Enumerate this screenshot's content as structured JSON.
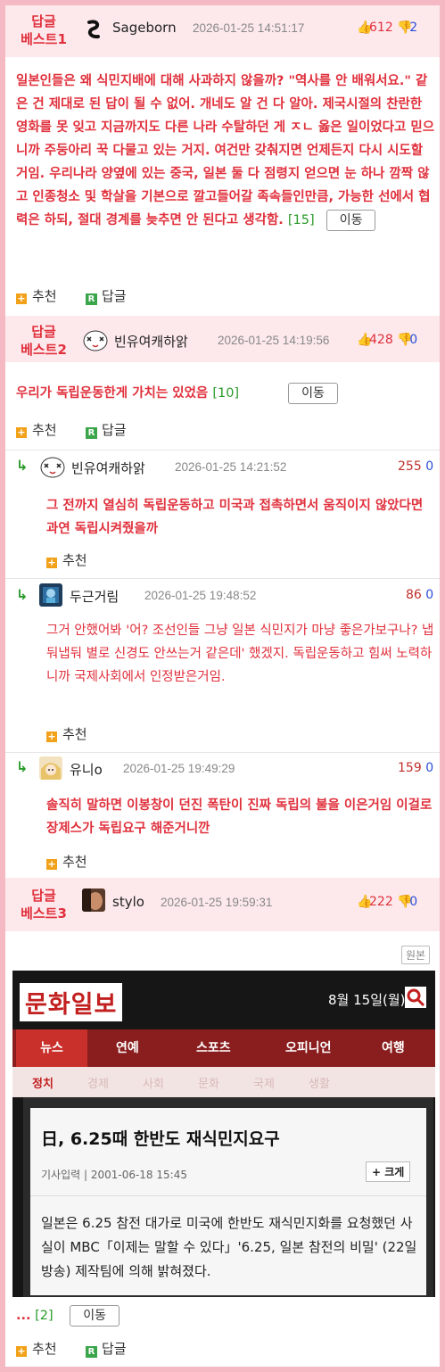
{
  "best1": {
    "tag": "답글\n베스트1",
    "nickname": "Sageborn",
    "date": "2026-01-25 14:51:17",
    "up": "612",
    "down": "2",
    "body": "일본인들은 왜 식민지배에 대해 사과하지 않을까? \"역사를 안 배워서요.\" 같은 건 제대로 된 답이 될 수 없어. 개네도 알 건 다 알아. 제국시절의 찬란한 영화를 못 잊고 지금까지도 다른 나라 수탈하던 게 ㅈㄴ 옳은 일이었다고 믿으니까 주둥아리 꾹 다물고 있는 거지. 여건만 갖춰지면 언제든지 다시 시도할 거임. 우리나라 양옆에 있는 중국, 일본 둘 다 점령지 얻으면 눈 하나 깜짝 않고 인종청소 및 학살을 기본으로 깔고들어갈 족속들인만큼, 가능한 선에서 협력은 하되, 절대 경계를 늦추면 안 된다고 생각함.",
    "reply_count": "[15]",
    "move_label": "이동",
    "recommend": "추천",
    "reply": "답글"
  },
  "best2": {
    "tag": "답글\n베스트2",
    "nickname": "빈유여캐하앍",
    "date": "2026-01-25 14:19:56",
    "up": "428",
    "down": "0",
    "body": "우리가 독립운동한게 가치는 있었음",
    "reply_count": "[10]",
    "move_label": "이동",
    "recommend": "추천",
    "reply": "답글"
  },
  "replies": [
    {
      "nickname": "빈유여캐하앍",
      "date": "2026-01-25 14:21:52",
      "up": "255",
      "down": "0",
      "body": "그 전까지 열심히 독립운동하고 미국과 접촉하면서 움직이지 않았다면 과연 독립시켜줬을까",
      "recommend": "추천"
    },
    {
      "nickname": "두근거림",
      "date": "2026-01-25 19:48:52",
      "up": "86",
      "down": "0",
      "body": "그거 안했어봐 '어? 조선인들 그냥 일본 식민지가 마냥 좋은가보구나? 냅둬냅둬 별로 신경도 안쓰는거 같은데' 했겠지. 독립운동하고 힘써 노력하니까 국제사회에서 인정받은거임.",
      "recommend": "추천"
    },
    {
      "nickname": "유니o",
      "date": "2026-01-25 19:49:29",
      "up": "159",
      "down": "0",
      "body": "솔직히 말하면 이봉창이 던진 폭탄이 진짜 독립의 불을 이은거임 이걸로 장제스가 독립요구 해준거니깐",
      "recommend": "추천"
    }
  ],
  "best3": {
    "tag": "답글\n베스트3",
    "nickname": "stylo",
    "date": "2026-01-25 19:59:31",
    "up": "222",
    "down": "0",
    "original_label": "원본",
    "tail": "...",
    "reply_count": "[2]",
    "move_label": "이동",
    "recommend": "추천",
    "reply": "답글",
    "news": {
      "logo": "문화일보",
      "date": "8월 15일(월)",
      "nav": [
        "뉴스",
        "연예",
        "스포츠",
        "오피니언",
        "여행"
      ],
      "subnav": [
        "정치",
        "경제",
        "사회",
        "문화",
        "국제",
        "생활"
      ],
      "headline": "日, 6.25때 한반도 재식민지요구",
      "meta": "기사입력 | 2001-06-18 15:45",
      "size_label": "+ 크게",
      "body": "일본은 6.25 참전 대가로 미국에 한반도 재식민지화를 요청했던 사실이 MBC「이제는 말할 수 있다」'6.25, 일본 참전의 비밀' (22일 방송) 제작팀에 의해 밝혀졌다."
    }
  },
  "colors": {
    "border": "#f4b9c2",
    "header_bg": "#fde9ec",
    "accent_red": "#e0303c",
    "down_blue": "#2a4fd8",
    "green": "#2a9a2a"
  }
}
